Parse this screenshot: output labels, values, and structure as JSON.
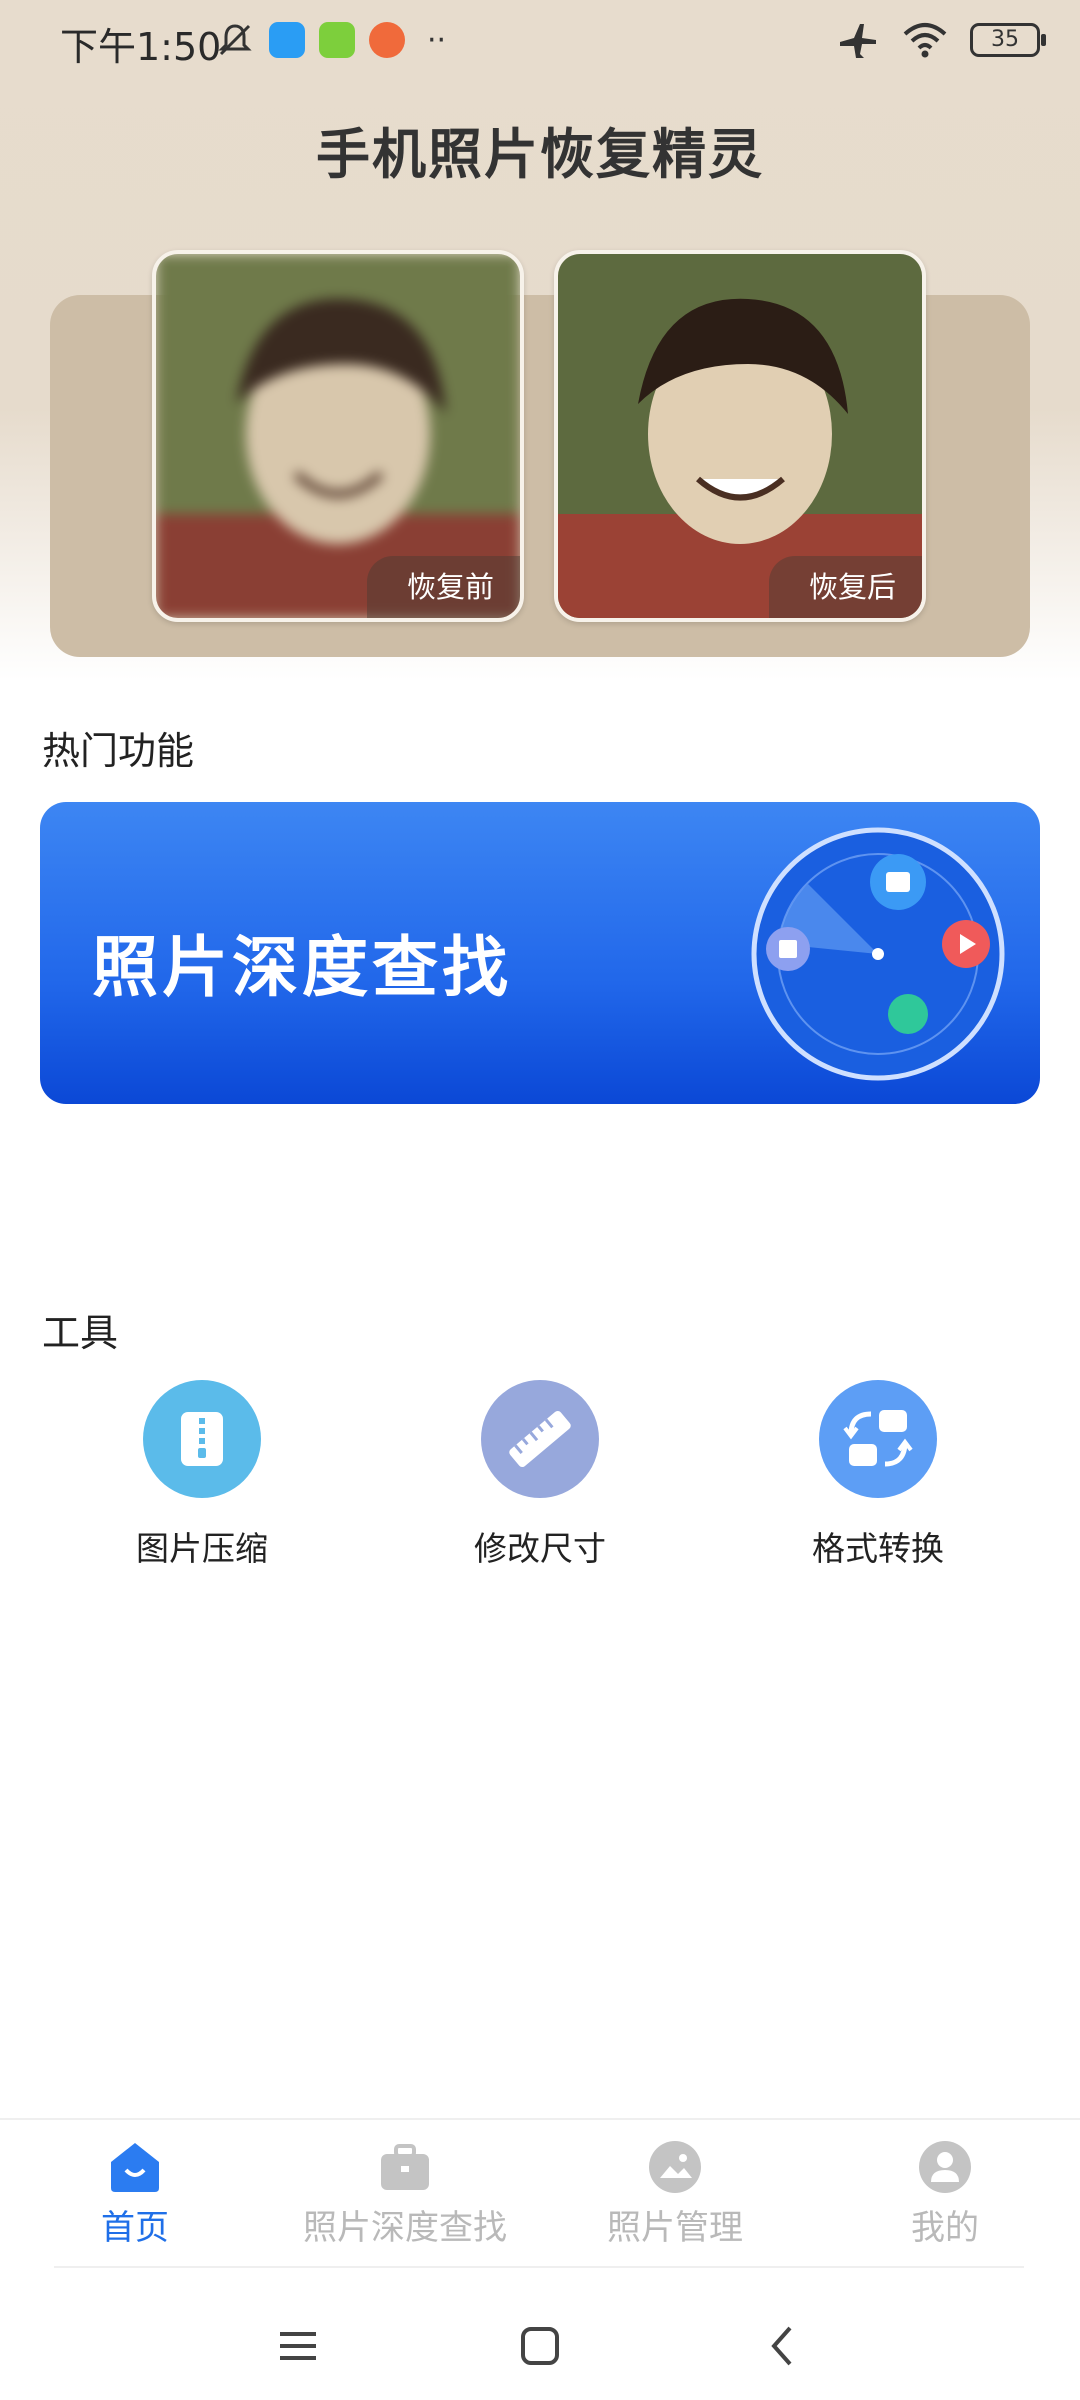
{
  "status_bar": {
    "time": "下午1:50",
    "battery": "35",
    "icons": [
      "mute-icon",
      "app-icon-blue",
      "app-icon-green-download",
      "app-icon-orange",
      "more-dots-icon",
      "airplane-icon",
      "wifi-icon",
      "battery-icon"
    ]
  },
  "app": {
    "title": "手机照片恢复精灵"
  },
  "compare": {
    "before_label": "恢复前",
    "after_label": "恢复后"
  },
  "hot": {
    "section_title": "热门功能",
    "banner_title": "照片深度查找"
  },
  "tools": {
    "section_title": "工具",
    "items": [
      {
        "label": "图片压缩",
        "icon": "zip-file-icon",
        "color": "#5bbbea"
      },
      {
        "label": "修改尺寸",
        "icon": "ruler-icon",
        "color": "#97a8dc"
      },
      {
        "label": "格式转换",
        "icon": "format-convert-icon",
        "color": "#5d9ef5"
      }
    ]
  },
  "tabbar": {
    "items": [
      {
        "label": "首页",
        "icon": "home-icon",
        "active": true
      },
      {
        "label": "照片深度查找",
        "icon": "briefcase-icon",
        "active": false
      },
      {
        "label": "照片管理",
        "icon": "image-icon",
        "active": false
      },
      {
        "label": "我的",
        "icon": "profile-icon",
        "active": false
      }
    ]
  },
  "colors": {
    "accent": "#1f6fe8",
    "header_bg": "#e7dccd",
    "compare_card": "#cdbda6",
    "inactive_tab": "#b9b9b9"
  }
}
